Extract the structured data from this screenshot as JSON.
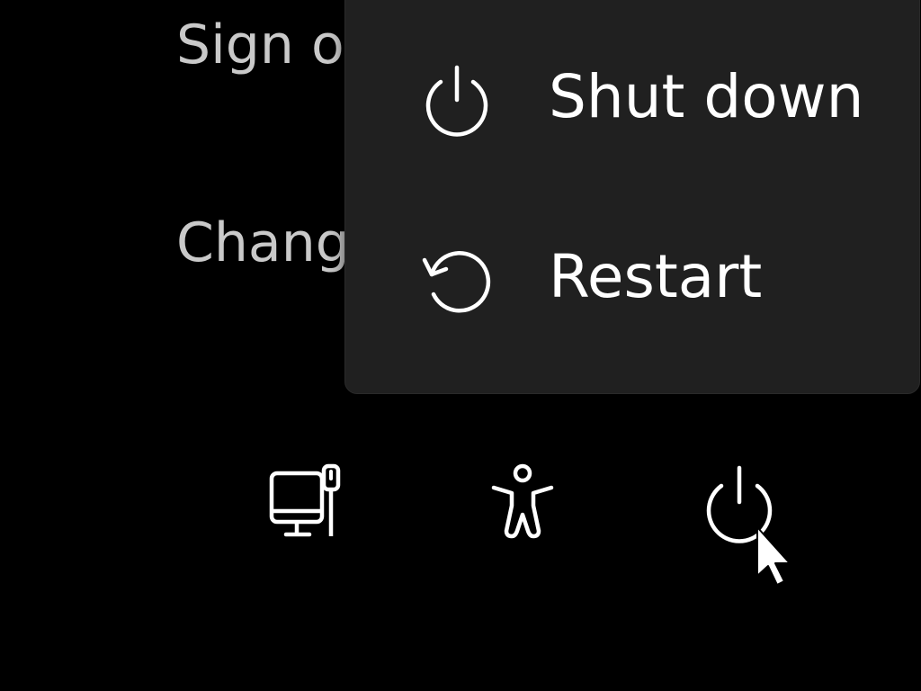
{
  "background_options": {
    "sign_out_label": "Sign o",
    "change_label": "Chang"
  },
  "power_menu": {
    "shutdown_label": "Shut down",
    "shutdown_icon": "power-icon",
    "restart_label": "Restart",
    "restart_icon": "restart-icon"
  },
  "bottom_bar": {
    "icons": [
      "network-icon",
      "accessibility-icon",
      "power-icon"
    ]
  },
  "colors": {
    "background": "#000000",
    "menu_background": "#202020",
    "menu_text": "#ffffff",
    "dimmed_text": "#c9c9c9"
  }
}
